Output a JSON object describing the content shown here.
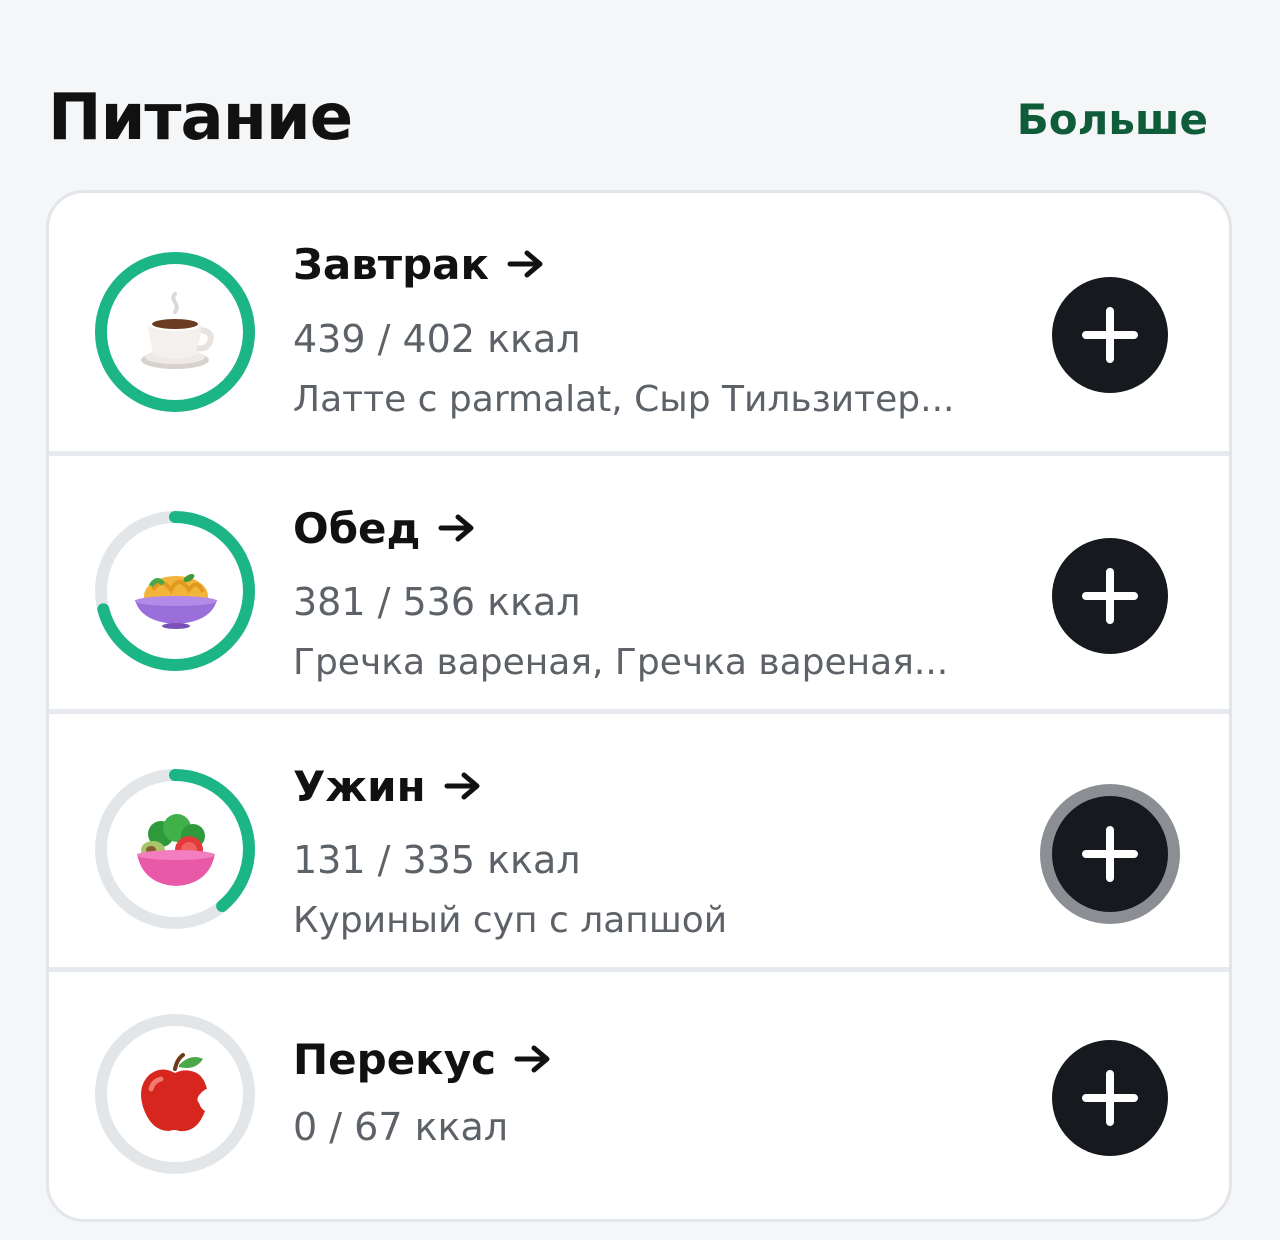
{
  "header": {
    "title": "Питание",
    "more_label": "Больше"
  },
  "colors": {
    "accent": "#1cb585",
    "ring_track": "#e3e6e9",
    "button": "#16191e",
    "more_link": "#0f5c3a"
  },
  "meals": [
    {
      "title": "Завтрак",
      "kcal": "439 / 402 ккал",
      "foods": "Латте с parmalat, Сыр Тильзитер...",
      "progress": 1.0,
      "icon": "coffee-cup-icon"
    },
    {
      "title": "Обед",
      "kcal": "381 / 536 ккал",
      "foods": "Гречка вареная, Гречка вареная...",
      "progress": 0.71,
      "icon": "pasta-bowl-icon"
    },
    {
      "title": "Ужин",
      "kcal": "131 / 335 ккал",
      "foods": "Куриный суп с лапшой",
      "progress": 0.39,
      "icon": "salad-bowl-icon"
    },
    {
      "title": "Перекус",
      "kcal": "0 / 67 ккал",
      "foods": "",
      "progress": 0.0,
      "icon": "apple-icon"
    }
  ]
}
